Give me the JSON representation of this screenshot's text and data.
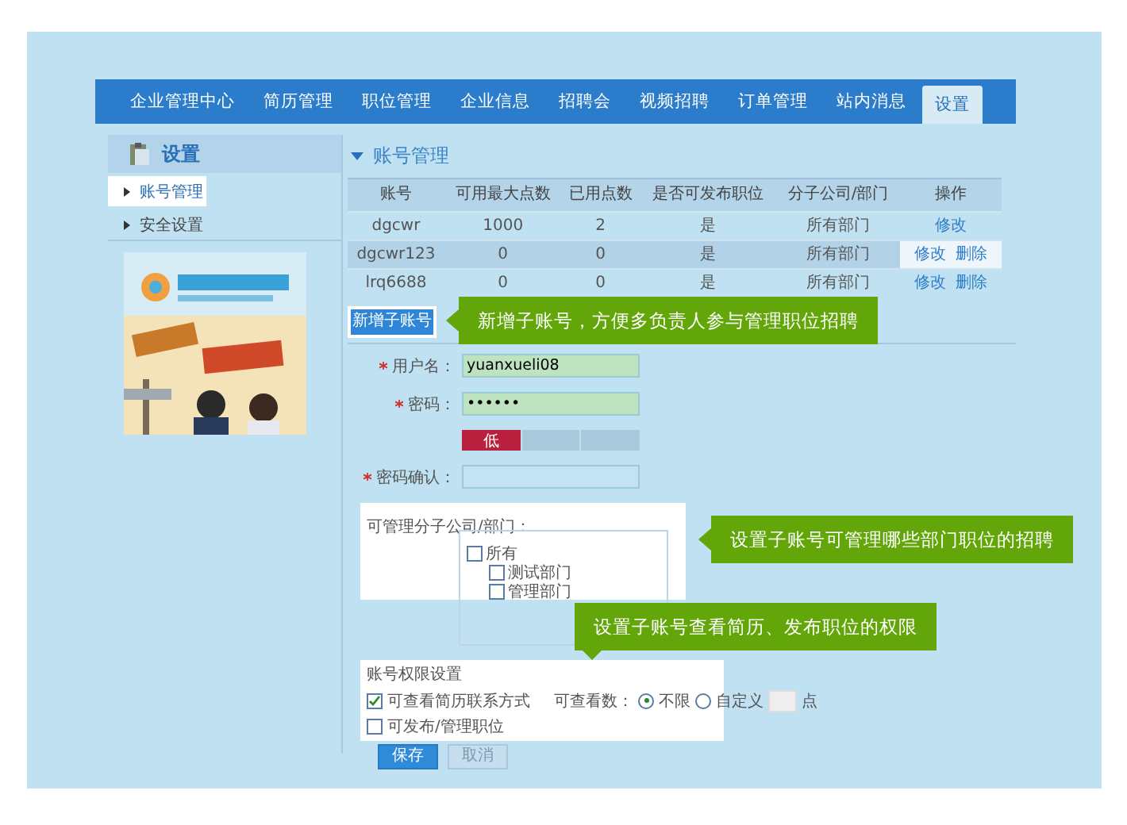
{
  "nav": {
    "tabs": [
      {
        "label": "企业管理中心",
        "selected": false
      },
      {
        "label": "简历管理",
        "selected": false
      },
      {
        "label": "职位管理",
        "selected": false
      },
      {
        "label": "企业信息",
        "selected": false
      },
      {
        "label": "招聘会",
        "selected": false
      },
      {
        "label": "视频招聘",
        "selected": false
      },
      {
        "label": "订单管理",
        "selected": false
      },
      {
        "label": "站内消息",
        "selected": false
      },
      {
        "label": "设置",
        "selected": true
      }
    ]
  },
  "sidebar": {
    "title": "设置",
    "items": [
      {
        "label": "账号管理",
        "selected": true
      },
      {
        "label": "安全设置",
        "selected": false
      }
    ]
  },
  "section_title": "账号管理",
  "table": {
    "columns": [
      "账号",
      "可用最大点数",
      "已用点数",
      "是否可发布职位",
      "分子公司/部门",
      "操作"
    ],
    "rows": [
      {
        "cells": [
          "dgcwr",
          "1000",
          "2",
          "是",
          "所有部门"
        ],
        "actions": [
          "修改"
        ],
        "highlighted": false
      },
      {
        "cells": [
          "dgcwr123",
          "0",
          "0",
          "是",
          "所有部门"
        ],
        "actions": [
          "修改",
          "删除"
        ],
        "highlighted": true
      },
      {
        "cells": [
          "lrq6688",
          "0",
          "0",
          "是",
          "所有部门"
        ],
        "actions": [
          "修改",
          "删除"
        ],
        "highlighted": false
      }
    ]
  },
  "add_button": "新增子账号",
  "form": {
    "fields": [
      {
        "label": "用户名：",
        "required": true,
        "value": "yuanxueli08",
        "valid": true
      },
      {
        "label": "密码：",
        "required": true,
        "value": "••••••",
        "valid": true
      },
      {
        "label": "密码确认：",
        "required": true,
        "valid": false
      }
    ],
    "strength": {
      "label": "低",
      "level": 0.33
    }
  },
  "departments": {
    "label": "可管理分子公司/部门：",
    "tree": [
      {
        "label": "所有",
        "checked": false,
        "children": [
          {
            "label": "测试部门",
            "checked": false
          },
          {
            "label": "管理部门",
            "checked": false
          }
        ]
      }
    ]
  },
  "permissions": {
    "title": "账号权限设置",
    "resume_contact": {
      "label": "可查看简历联系方式",
      "checked": true
    },
    "view_count_label": "可查看数：",
    "radios": [
      {
        "label": "不限",
        "selected": true
      },
      {
        "label": "自定义",
        "selected": false
      }
    ],
    "unit": "点",
    "publish": {
      "label": "可发布/管理职位",
      "checked": false
    }
  },
  "buttons": {
    "save": "保存",
    "cancel": "取消"
  },
  "callouts": [
    {
      "text": "新增子账号，方便多负责人参与管理职位招聘",
      "kind": "left"
    },
    {
      "text": "设置子账号可管理哪些部门职位的招聘",
      "kind": "left"
    },
    {
      "text": "设置子账号查看简历、发布职位的权限",
      "kind": "down"
    }
  ]
}
